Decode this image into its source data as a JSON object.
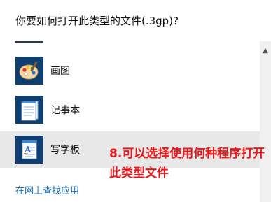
{
  "dialog": {
    "title": "你要如何打开此类型的文件(.3gp)?"
  },
  "apps": [
    {
      "label": "画图",
      "icon": "paint-icon"
    },
    {
      "label": "记事本",
      "icon": "notepad-icon"
    },
    {
      "label": "写字板",
      "icon": "wordpad-icon",
      "selected": true
    }
  ],
  "store_link": "在网上查找应用",
  "annotation": "8.可以选择使用何种程序打开此类型文件",
  "colors": {
    "icon_tile": "#0f3f71",
    "selected_row": "#e8e8e8",
    "link": "#1e6fb8",
    "annotation": "#e8181b"
  }
}
